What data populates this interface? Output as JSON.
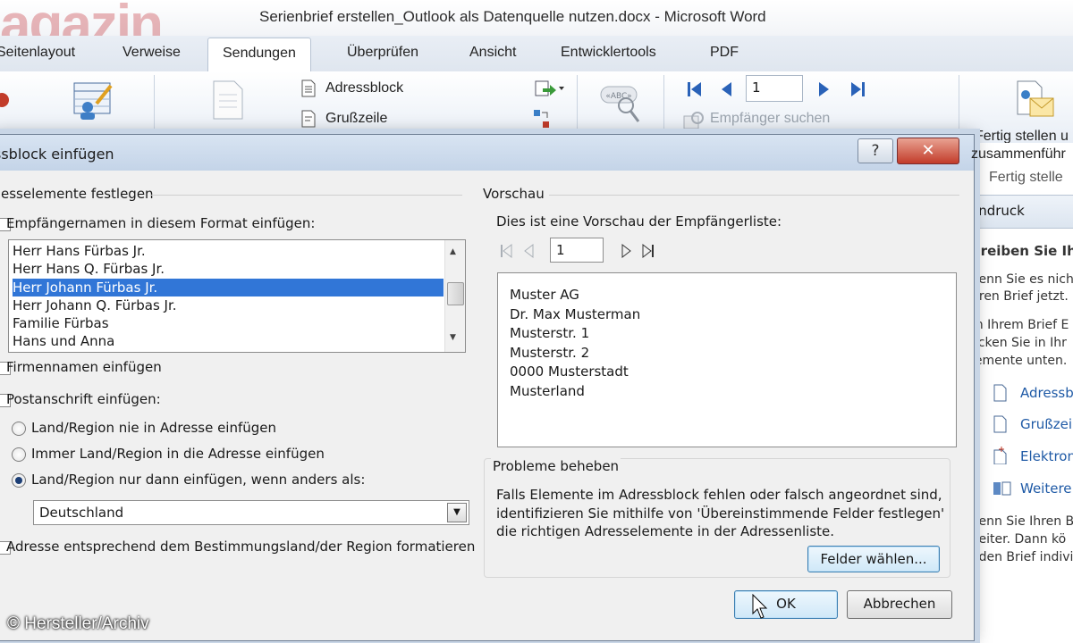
{
  "window": {
    "title": "Serienbrief erstellen_Outlook als Datenquelle nutzen.docx - Microsoft Word",
    "watermark": "agazin"
  },
  "ribbon": {
    "tabs": [
      "Seitenlayout",
      "Verweise",
      "Sendungen",
      "Überprüfen",
      "Ansicht",
      "Entwicklertools",
      "PDF"
    ],
    "active_tab": "Sendungen",
    "adressblock_label": "Adressblock",
    "grusszeile_label": "Grußzeile",
    "record_number": "1",
    "find_recipient_label": "Empfänger suchen",
    "finish_label_1": "Fertig stellen u",
    "finish_label_2": "zusammenführ",
    "finish_group_label": "Fertig stelle"
  },
  "task_pane": {
    "header": "endruck",
    "heading": "hreiben Sie Ih",
    "text_1": "Venn Sie es nich",
    "text_2": "hren Brief jetzt.",
    "text_3": "m Ihrem Brief E",
    "text_4": "licken Sie in Ihr",
    "text_5": "lemente unten.",
    "links": [
      "Adressb",
      "Grußzeil",
      "Elektron",
      "Weitere"
    ],
    "text_6": "Venn Sie Ihren B",
    "text_7": "Veiter. Dann kö",
    "text_8": "eden Brief indivi"
  },
  "dialog": {
    "title": "ssblock einfügen",
    "help_label": "?",
    "close_label": "✕",
    "left_group_title": "esselemente festlegen",
    "names_checkbox_label": "Empfängernamen in diesem Format einfügen:",
    "name_formats": [
      "Herr Hans Fürbas Jr.",
      "Herr Hans Q. Fürbas Jr.",
      "Herr Johann Fürbas Jr.",
      "Herr Johann Q. Fürbas Jr.",
      "Familie Fürbas",
      "Hans und Anna"
    ],
    "selected_name_format": "Herr Johann Fürbas Jr.",
    "company_checkbox_label": "Firmennamen einfügen",
    "postal_checkbox_label": "Postanschrift einfügen:",
    "radio_never": "Land/Region nie in Adresse einfügen",
    "radio_always": "Immer Land/Region in die Adresse einfügen",
    "radio_unless": "Land/Region nur dann einfügen, wenn anders als:",
    "selected_radio": "Land/Region nur dann einfügen, wenn anders als:",
    "country_value": "Deutschland",
    "format_checkbox_label": "Adresse entsprechend dem Bestimmungsland/der Region formatieren",
    "preview_group_title": "Vorschau",
    "preview_intro": "Dies ist eine Vorschau der Empfängerliste:",
    "preview_record": "1",
    "preview_lines": [
      "Muster AG",
      "Dr. Max Musterman",
      "Musterstr. 1",
      "Musterstr. 2",
      "0000 Musterstadt",
      "Musterland"
    ],
    "problems_title": "Probleme beheben",
    "problems_text_1": "Falls Elemente im Adressblock fehlen oder falsch angeordnet sind,",
    "problems_text_2": "identifizieren Sie mithilfe von 'Übereinstimmende Felder festlegen'",
    "problems_text_3": "die richtigen Adresselemente in der Adressenliste.",
    "fields_button": "Felder wählen...",
    "ok_button": "OK",
    "cancel_button": "Abbrechen"
  },
  "copyright": "© Hersteller/Archiv",
  "colors": {
    "selection": "#3176d7",
    "close_red": "#c23c2a",
    "link_blue": "#1f5aa6"
  }
}
